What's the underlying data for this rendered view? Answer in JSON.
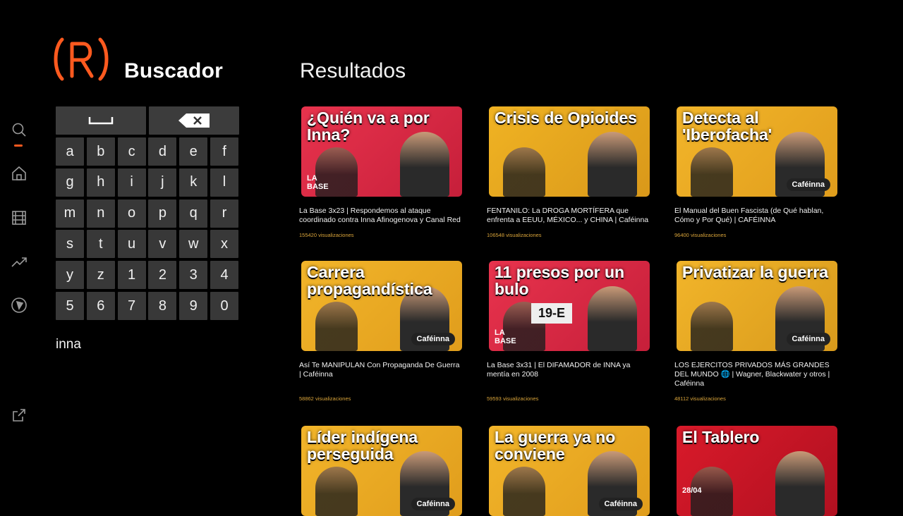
{
  "app": {
    "logo_label": "(R)",
    "title": "Buscador",
    "accent_color": "#ff5a1f"
  },
  "sidebar": {
    "items": [
      {
        "name": "search-icon",
        "active": true
      },
      {
        "name": "home-icon",
        "active": false
      },
      {
        "name": "film-icon",
        "active": false
      },
      {
        "name": "trending-icon",
        "active": false
      },
      {
        "name": "explore-icon",
        "active": false
      },
      {
        "name": "external-link-icon",
        "active": false
      }
    ]
  },
  "keyboard": {
    "space_icon": "space-bar-icon",
    "backspace_icon": "backspace-icon",
    "rows": [
      [
        "a",
        "b",
        "c",
        "d",
        "e",
        "f"
      ],
      [
        "g",
        "h",
        "i",
        "j",
        "k",
        "l"
      ],
      [
        "m",
        "n",
        "o",
        "p",
        "q",
        "r"
      ],
      [
        "s",
        "t",
        "u",
        "v",
        "w",
        "x"
      ],
      [
        "y",
        "z",
        "1",
        "2",
        "3",
        "4"
      ],
      [
        "5",
        "6",
        "7",
        "8",
        "9",
        "0"
      ]
    ]
  },
  "search": {
    "query": "inna"
  },
  "results": {
    "heading": "Resultados",
    "items": [
      {
        "thumb_text": "¿Quién va a por Inna?",
        "thumb_badge": "LA\nBASE",
        "title": "La Base 3x23 | Respondemos al ataque coordinado contra Inna Afinogenova y Canal Red",
        "views": "155420 visualizaciones"
      },
      {
        "thumb_text": "Crisis de Opioides",
        "thumb_badge": "",
        "title": "FENTANILO: La DROGA MORTÍFERA que enfrenta a EEUU, MÉXICO... y CHINA | Caféinna",
        "views": "106548 visualizaciones"
      },
      {
        "thumb_text": "Detecta al 'Iberofacha'",
        "thumb_badge": "Caféinna",
        "title": "El Manual del Buen Fascista (de Qué hablan, Cómo y Por Qué) | CAFÉINNA",
        "views": "96400 visualizaciones"
      },
      {
        "thumb_text": "Carrera propagandística",
        "thumb_badge": "Caféinna",
        "title": "Así Te MANIPULAN Con Propaganda De Guerra | Caféinna",
        "views": "58862 visualizaciones"
      },
      {
        "thumb_text": "11 presos por un bulo",
        "thumb_badge": "LA\nBASE",
        "thumb_sub": "19-E",
        "title": "La Base 3x31 | El DIFAMADOR de INNA ya mentía en 2008",
        "views": "59593 visualizaciones"
      },
      {
        "thumb_text": "Privatizar la guerra",
        "thumb_badge": "Caféinna",
        "title": "LOS EJERCITOS PRIVADOS MÁS GRANDES DEL MUNDO 🌐 | Wagner, Blackwater y otros | Caféinna",
        "views": "48112 visualizaciones"
      },
      {
        "thumb_text": "Líder indígena perseguida",
        "thumb_badge": "Caféinna",
        "title": "",
        "views": ""
      },
      {
        "thumb_text": "La guerra ya no conviene",
        "thumb_badge": "Caféinna",
        "title": "",
        "views": ""
      },
      {
        "thumb_text": "El Tablero",
        "thumb_badge": "28/04",
        "title": "",
        "views": ""
      }
    ]
  }
}
